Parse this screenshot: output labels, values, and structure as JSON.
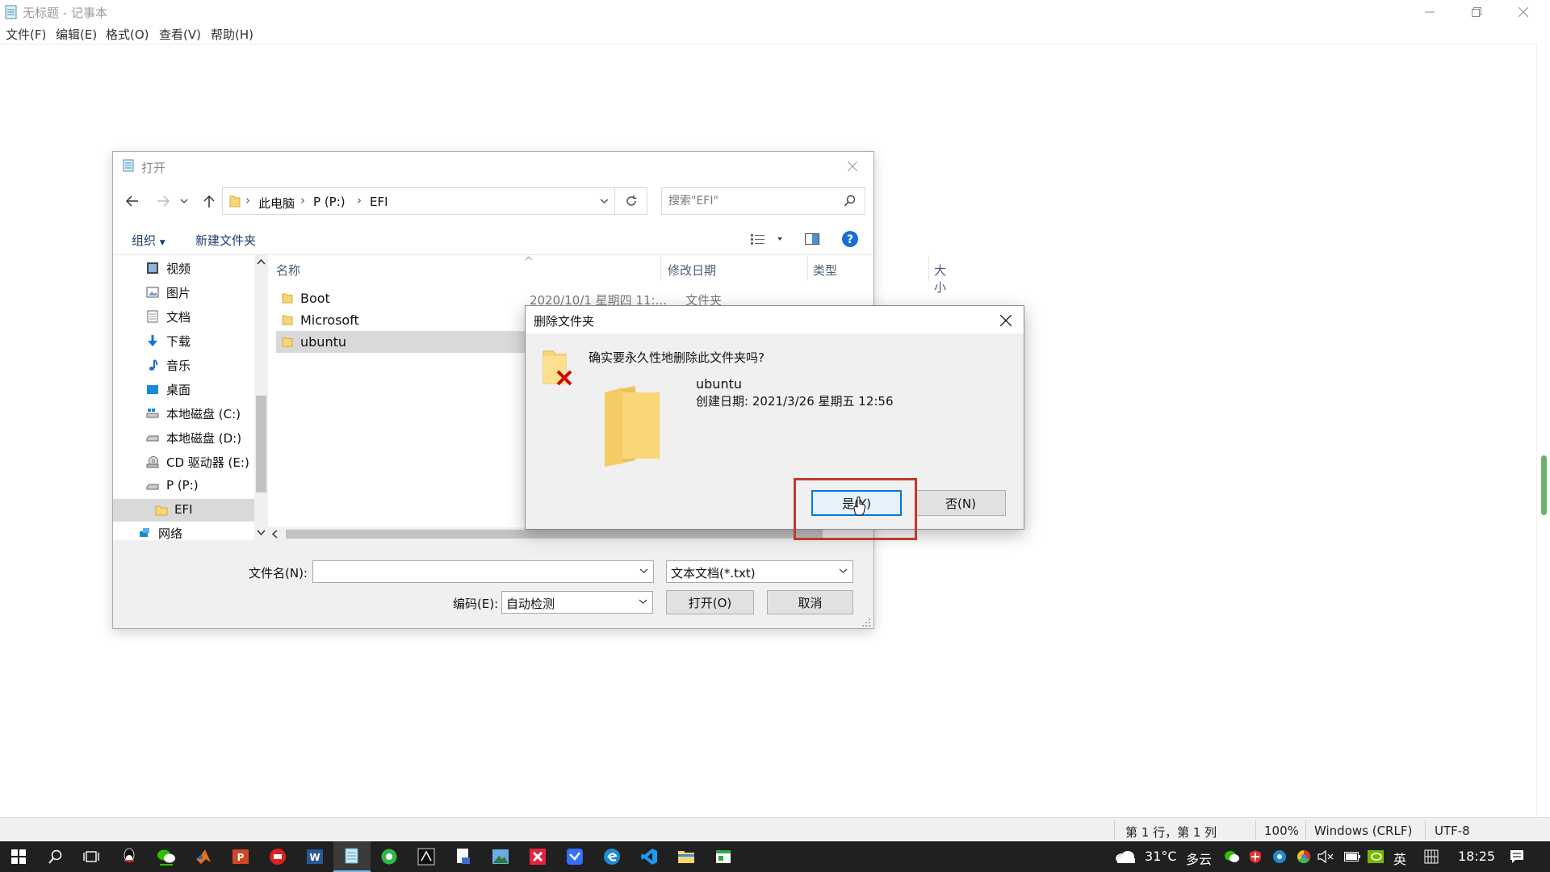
{
  "notepad": {
    "title": "无标题 - 记事本",
    "menu": [
      "文件(F)",
      "编辑(E)",
      "格式(O)",
      "查看(V)",
      "帮助(H)"
    ],
    "status": {
      "position": "第 1 行，第 1 列",
      "zoom": "100%",
      "line_ending": "Windows (CRLF)",
      "encoding": "UTF-8"
    }
  },
  "open_dialog": {
    "title": "打开",
    "breadcrumb": [
      "此电脑",
      "P (P:)",
      "EFI"
    ],
    "search_placeholder": "搜索\"EFI\"",
    "toolbar": {
      "organize": "组织",
      "new_folder": "新建文件夹"
    },
    "nav_items": [
      {
        "label": "视频",
        "icon": "video-icon"
      },
      {
        "label": "图片",
        "icon": "pictures-icon"
      },
      {
        "label": "文档",
        "icon": "documents-icon"
      },
      {
        "label": "下载",
        "icon": "download-icon"
      },
      {
        "label": "音乐",
        "icon": "music-icon"
      },
      {
        "label": "桌面",
        "icon": "desktop-icon"
      },
      {
        "label": "本地磁盘 (C:)",
        "icon": "drive-icon"
      },
      {
        "label": "本地磁盘 (D:)",
        "icon": "drive-icon"
      },
      {
        "label": "CD 驱动器 (E:)",
        "icon": "cd-drive-icon"
      },
      {
        "label": "P (P:)",
        "icon": "drive-icon"
      },
      {
        "label": "EFI",
        "icon": "folder-icon"
      },
      {
        "label": "网络",
        "icon": "network-icon"
      }
    ],
    "columns": [
      "名称",
      "修改日期",
      "类型",
      "大小"
    ],
    "files": [
      {
        "name": "Boot",
        "date": "2020/10/1 星期四 11:...",
        "type": "文件夹"
      },
      {
        "name": "Microsoft",
        "date": "",
        "type": ""
      },
      {
        "name": "ubuntu",
        "date": "",
        "type": ""
      }
    ],
    "filename_label": "文件名(N):",
    "filename_value": "",
    "filetype_value": "文本文档(*.txt)",
    "encoding_label": "编码(E):",
    "encoding_value": "自动检测",
    "open_button": "打开(O)",
    "cancel_button": "取消"
  },
  "delete_dialog": {
    "title": "删除文件夹",
    "question": "确实要永久性地删除此文件夹吗?",
    "folder_name": "ubuntu",
    "created": "创建日期: 2021/3/26 星期五 12:56",
    "yes_button": "是(Y)",
    "no_button": "否(N)"
  },
  "taskbar": {
    "weather": "31°C",
    "weather_desc": "多云",
    "ime": "英",
    "clock": "18:25"
  },
  "colors": {
    "highlight_box": "#c0392b",
    "primary_button_border": "#0078d7",
    "taskbar": "#202020"
  }
}
